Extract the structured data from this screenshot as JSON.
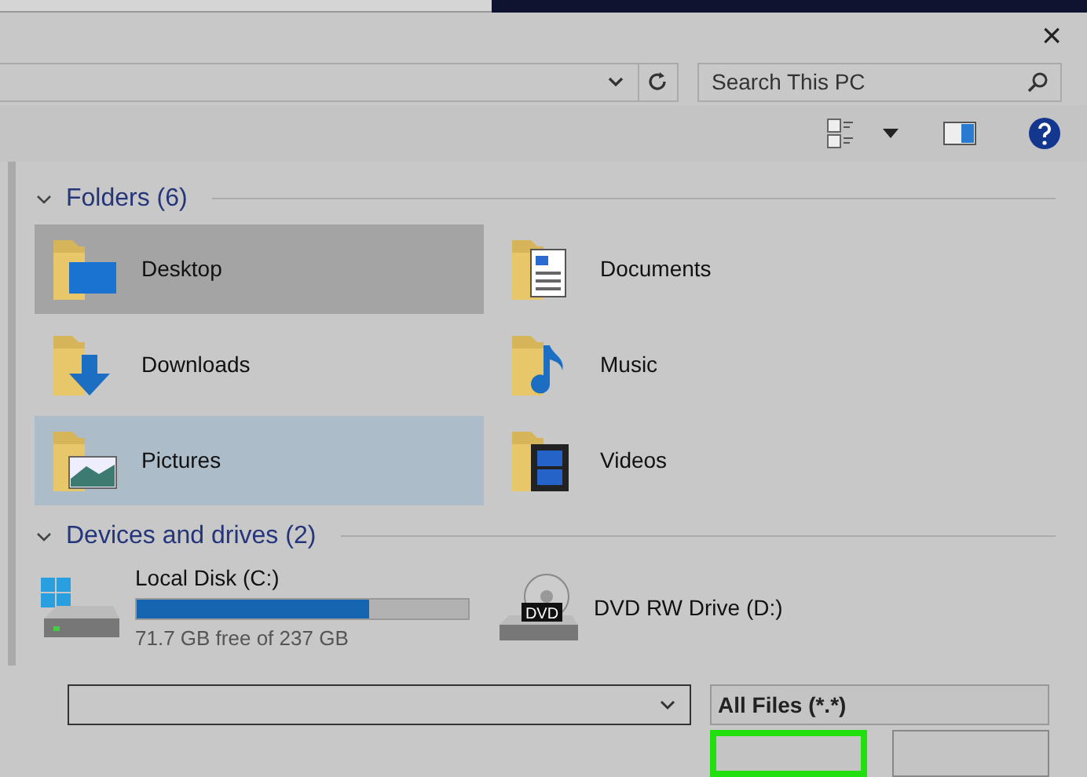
{
  "close_label": "×",
  "search": {
    "placeholder": "Search This PC"
  },
  "folders": {
    "title": "Folders (6)",
    "expanded": true,
    "items": [
      {
        "label": "Desktop",
        "kind": "desktop",
        "selected": false,
        "hovered": true
      },
      {
        "label": "Documents",
        "kind": "documents",
        "selected": false,
        "hovered": false
      },
      {
        "label": "Downloads",
        "kind": "downloads",
        "selected": false,
        "hovered": false
      },
      {
        "label": "Music",
        "kind": "music",
        "selected": false,
        "hovered": false
      },
      {
        "label": "Pictures",
        "kind": "pictures",
        "selected": true,
        "hovered": false
      },
      {
        "label": "Videos",
        "kind": "videos",
        "selected": false,
        "hovered": false
      }
    ]
  },
  "drives": {
    "title": "Devices and drives (2)",
    "expanded": true,
    "items": [
      {
        "label": "Local Disk (C:)",
        "kind": "disk",
        "level": 0.7,
        "free": "71.7 GB free of 237 GB"
      },
      {
        "label": "DVD RW Drive (D:)",
        "kind": "dvd",
        "badge": "DVD"
      }
    ]
  },
  "file_type": "All Files (*.*)",
  "buttons": [
    {
      "highlighted": true
    },
    {
      "highlighted": false
    }
  ]
}
